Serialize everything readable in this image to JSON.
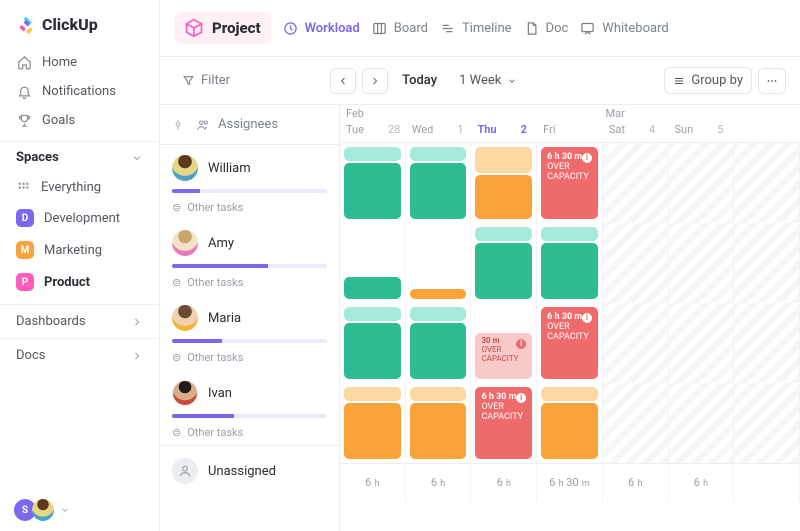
{
  "brand": {
    "name": "ClickUp"
  },
  "sidebar": {
    "nav": [
      {
        "label": "Home"
      },
      {
        "label": "Notifications"
      },
      {
        "label": "Goals"
      }
    ],
    "spacesHeader": "Spaces",
    "spaces": [
      {
        "badge": "::",
        "label": "Everything",
        "color": "#c9ccd4"
      },
      {
        "badge": "D",
        "label": "Development",
        "color": "#7b68ee"
      },
      {
        "badge": "M",
        "label": "Marketing",
        "color": "#f9a33a"
      },
      {
        "badge": "P",
        "label": "Product",
        "color": "#ff5bbd"
      }
    ],
    "rows": [
      {
        "label": "Dashboards"
      },
      {
        "label": "Docs"
      }
    ],
    "footerInitial": "S"
  },
  "topbar": {
    "project": "Project",
    "views": [
      {
        "label": "Workload"
      },
      {
        "label": "Board"
      },
      {
        "label": "Timeline"
      },
      {
        "label": "Doc"
      },
      {
        "label": "Whiteboard"
      }
    ]
  },
  "toolbar": {
    "filter": "Filter",
    "today": "Today",
    "range": "1 Week",
    "groupBy": "Group by"
  },
  "workload": {
    "colHeader": "Assignees",
    "months": [
      "Feb",
      "",
      "",
      "",
      "Mar",
      "",
      ""
    ],
    "days": [
      {
        "dow": "Tue",
        "num": "28"
      },
      {
        "dow": "Wed",
        "num": "1"
      },
      {
        "dow": "Thu",
        "num": "2"
      },
      {
        "dow": "Fri",
        "num": ""
      },
      {
        "dow": "Sat",
        "num": "4"
      },
      {
        "dow": "Sun",
        "num": "5"
      },
      {
        "dow": "",
        "num": ""
      }
    ],
    "todayIndex": 2,
    "people": [
      {
        "name": "William",
        "progress": 18,
        "other": "Other tasks"
      },
      {
        "name": "Amy",
        "progress": 62,
        "other": "Other tasks"
      },
      {
        "name": "Maria",
        "progress": 32,
        "other": "Other tasks"
      },
      {
        "name": "Ivan",
        "progress": 40,
        "other": "Other tasks"
      }
    ],
    "overCap": {
      "big": "6 h 30 m",
      "label": "OVER CAPACITY",
      "mini": "30 m"
    },
    "unassigned": "Unassigned",
    "footer": [
      "6 h",
      "6 h",
      "6 h",
      "6 h  30 m",
      "6 h",
      "6 h",
      ""
    ]
  }
}
